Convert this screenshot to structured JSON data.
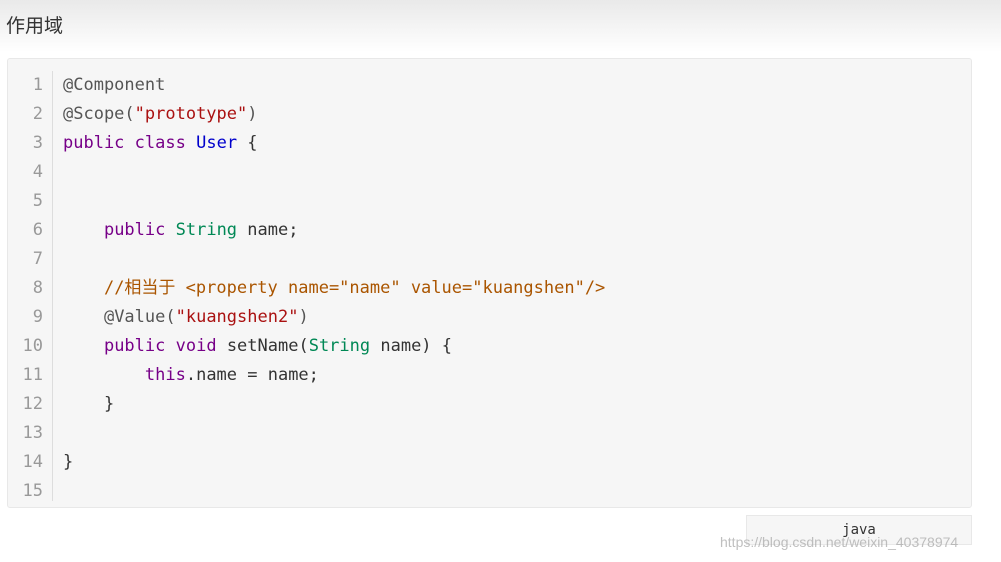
{
  "page": {
    "title": "作用域"
  },
  "code_block": {
    "language": "java",
    "line_numbers": [
      "1",
      "2",
      "3",
      "4",
      "5",
      "6",
      "7",
      "8",
      "9",
      "10",
      "11",
      "12",
      "13",
      "14",
      "15"
    ],
    "lines": [
      [
        {
          "t": "@Component",
          "c": "ann"
        }
      ],
      [
        {
          "t": "@Scope(",
          "c": "ann"
        },
        {
          "t": "\"prototype\"",
          "c": "str"
        },
        {
          "t": ")",
          "c": "ann"
        }
      ],
      [
        {
          "t": "public",
          "c": "kw"
        },
        {
          "t": " "
        },
        {
          "t": "class",
          "c": "kw"
        },
        {
          "t": " "
        },
        {
          "t": "User",
          "c": "cls"
        },
        {
          "t": " {"
        }
      ],
      [],
      [],
      [
        {
          "t": "    "
        },
        {
          "t": "public",
          "c": "kw"
        },
        {
          "t": " "
        },
        {
          "t": "String",
          "c": "ty"
        },
        {
          "t": " name;"
        }
      ],
      [],
      [
        {
          "t": "    "
        },
        {
          "t": "//相当于 <property name=\"name\" value=\"kuangshen\"/>",
          "c": "cmt"
        }
      ],
      [
        {
          "t": "    "
        },
        {
          "t": "@Value(",
          "c": "ann"
        },
        {
          "t": "\"kuangshen2\"",
          "c": "str"
        },
        {
          "t": ")",
          "c": "ann"
        }
      ],
      [
        {
          "t": "    "
        },
        {
          "t": "public",
          "c": "kw"
        },
        {
          "t": " "
        },
        {
          "t": "void",
          "c": "kw"
        },
        {
          "t": " setName("
        },
        {
          "t": "String",
          "c": "ty"
        },
        {
          "t": " name) {"
        }
      ],
      [
        {
          "t": "        "
        },
        {
          "t": "this",
          "c": "kw"
        },
        {
          "t": ".name = name;"
        }
      ],
      [
        {
          "t": "    }"
        }
      ],
      [],
      [
        {
          "t": "}"
        }
      ],
      []
    ]
  },
  "watermark": "https://blog.csdn.net/weixin_40378974"
}
